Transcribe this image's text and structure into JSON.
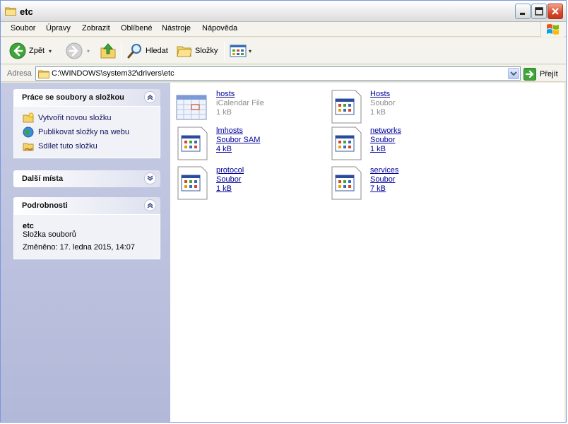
{
  "window": {
    "title": "etc"
  },
  "menu": [
    "Soubor",
    "Úpravy",
    "Zobrazit",
    "Oblíbené",
    "Nástroje",
    "Nápověda"
  ],
  "toolbar": {
    "back_label": "Zpět",
    "search_label": "Hledat",
    "folders_label": "Složky"
  },
  "address": {
    "label": "Adresa",
    "value": "C:\\WINDOWS\\system32\\drivers\\etc",
    "go_label": "Přejít"
  },
  "tasks_panel": {
    "title": "Práce se soubory a složkou",
    "items": [
      {
        "label": "Vytvořit novou složku",
        "icon": "new-folder-icon"
      },
      {
        "label": "Publikovat složky na webu",
        "icon": "globe-icon"
      },
      {
        "label": "Sdílet tuto složku",
        "icon": "share-folder-icon"
      }
    ]
  },
  "places_panel": {
    "title": "Další místa"
  },
  "details_panel": {
    "title": "Podrobnosti",
    "name": "etc",
    "type": "Složka souborů",
    "modified": "Změněno: 17. ledna 2015, 14:07"
  },
  "files": [
    {
      "name": "hosts",
      "type": "iCalendar File",
      "size": "1 kB",
      "icon": "calendar-file-icon",
      "dim": true
    },
    {
      "name": "Hosts",
      "type": "Soubor",
      "size": "1 kB",
      "icon": "generic-file-icon",
      "dim": true
    },
    {
      "name": "lmhosts",
      "type": "Soubor SAM",
      "size": "4 kB",
      "icon": "generic-file-icon",
      "dim": false
    },
    {
      "name": "networks",
      "type": "Soubor",
      "size": "1 kB",
      "icon": "generic-file-icon",
      "dim": false
    },
    {
      "name": "protocol",
      "type": "Soubor",
      "size": "1 kB",
      "icon": "generic-file-icon",
      "dim": false
    },
    {
      "name": "services",
      "type": "Soubor",
      "size": "7 kB",
      "icon": "generic-file-icon",
      "dim": false
    }
  ]
}
